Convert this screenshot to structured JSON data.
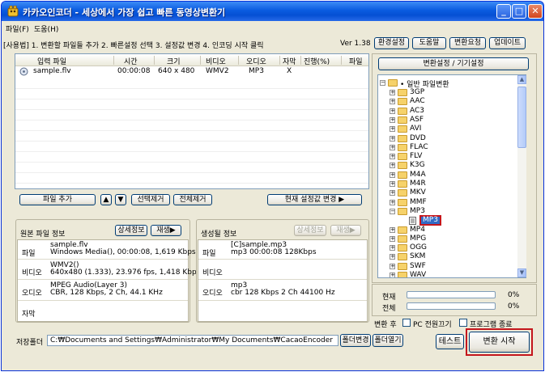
{
  "window": {
    "title": "카카오인코더 - 세상에서 가장 쉽고 빠른 동영상변환기"
  },
  "menu": [
    "파일(F)",
    "도움(H)"
  ],
  "toolbar": {
    "usage": "[사용법] 1. 변환할 파일들 추가 2. 빠른설정 선택 3. 설정값 변경 4. 인코딩 시작 클릭",
    "version": "Ver 1.38",
    "buttons": [
      "환경설정",
      "도움말",
      "변환요청",
      "업데이트"
    ]
  },
  "file_list": {
    "columns": [
      "입력 파일",
      "시간",
      "크기",
      "비디오",
      "오디오",
      "자막",
      "진행(%)",
      "파일"
    ],
    "rows": [
      {
        "file": "sample.flv",
        "time": "00:00:08",
        "size": "640 x 480",
        "video": "WMV2",
        "audio": "MP3",
        "subtitle": "X"
      }
    ],
    "add_button": "파일 추가",
    "up_icon": "▲",
    "down_icon": "▼",
    "remove_selected": "선택제거",
    "remove_all": "전체제거",
    "apply_current": "현재 설정값 변경 ▶"
  },
  "source_info": {
    "title": "원본 파일 정보",
    "detail_button": "상세정보",
    "play_button": "재생▶",
    "file_label": "파일",
    "file_value": [
      "sample.flv",
      "Windows Media(), 00:00:08, 1,619 Kbps"
    ],
    "video_label": "비디오",
    "video_value": [
      "WMV2()",
      "640x480 (1.333), 23.976 fps, 1,418 Kbps"
    ],
    "audio_label": "오디오",
    "audio_value": [
      "MPEG Audio(Layer 3)",
      "CBR, 128 Kbps, 2 Ch, 44.1 KHz"
    ],
    "subtitle_label": "자막"
  },
  "output_info": {
    "title": "생성될 정보",
    "detail_button": "상세정보",
    "play_button": "재생▶",
    "file_label": "파일",
    "file_value": [
      "[C]sample.mp3",
      "mp3  00:00:08  128Kbps"
    ],
    "video_label": "비디오",
    "audio_label": "오디오",
    "audio_value": [
      "mp3",
      "cbr    128 Kbps  2 Ch  44100 Hz"
    ]
  },
  "presets": {
    "title": "변환설정 / 기기설정",
    "root": "• 일반 파일변환",
    "items": [
      "3GP",
      "AAC",
      "AC3",
      "ASF",
      "AVI",
      "DVD",
      "FLAC",
      "FLV",
      "K3G",
      "M4A",
      "M4R",
      "MKV",
      "MMF",
      "MP3",
      "MP4",
      "MPG",
      "OGG",
      "SKM",
      "SWF",
      "WAV"
    ],
    "expanded": "MP3",
    "selected_child": "MP3"
  },
  "progress": {
    "current_label": "현재",
    "current_value": "0%",
    "current_fraction": 0,
    "total_label": "전체",
    "total_value": "0%",
    "total_fraction": 0
  },
  "after_convert": {
    "label": "변환 후",
    "shutdown": "PC 전원끄기",
    "exit": "프로그램 종료"
  },
  "output_folder": {
    "label": "저장폴더",
    "path": "C:₩Documents and Settings₩Administrator₩My Documents₩CacaoEncoder",
    "change_button": "폴더변경",
    "open_button": "폴더열기"
  },
  "actions": {
    "test": "테스트",
    "start": "변환 시작"
  }
}
